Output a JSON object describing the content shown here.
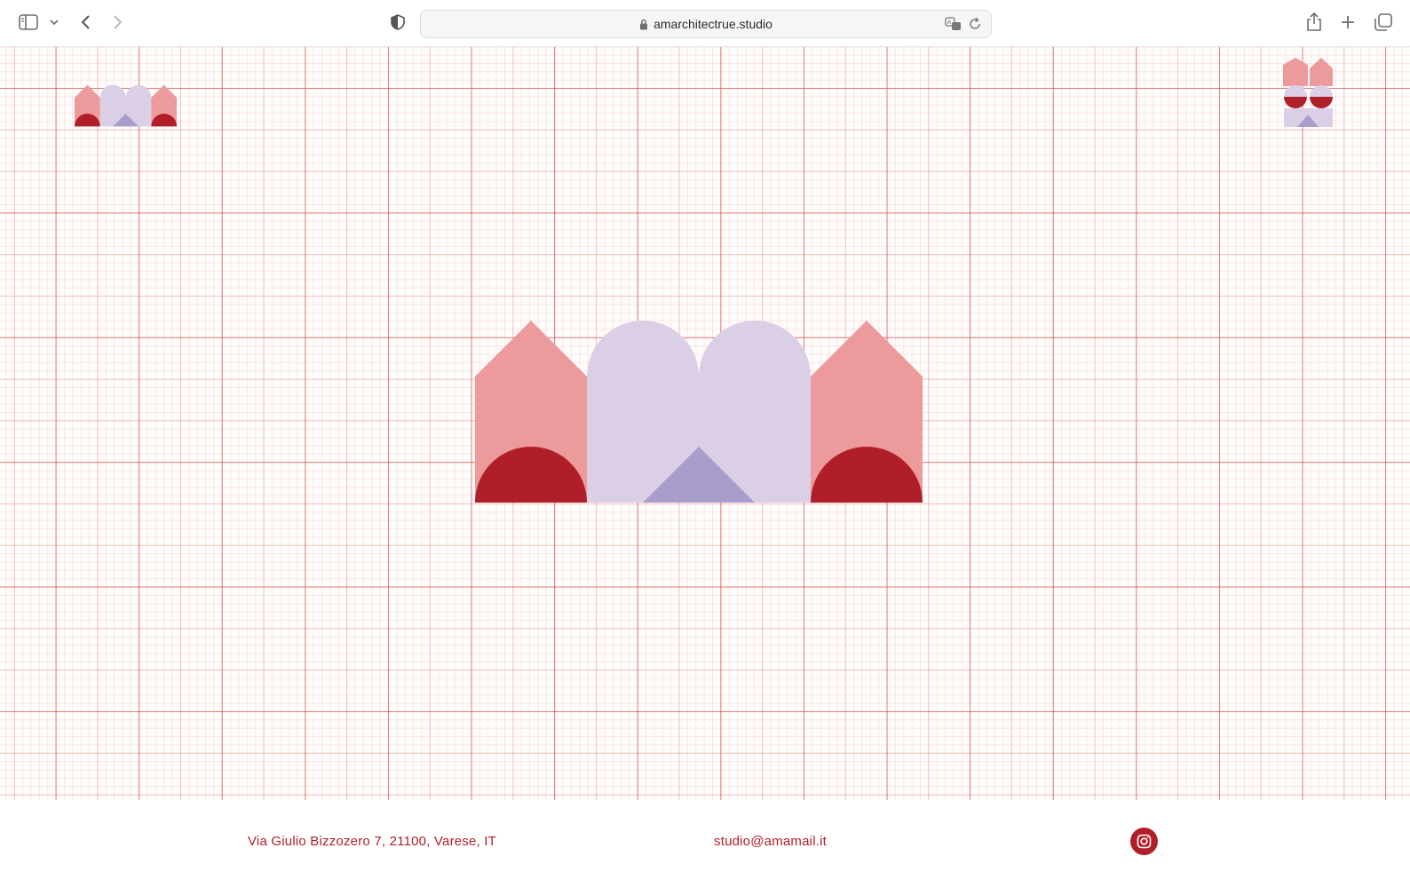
{
  "browser": {
    "url": "amarchitectrue.studio",
    "icons": {
      "sidebar": "sidebar-icon",
      "chevron": "chevron-down-icon",
      "back": "back-arrow-icon",
      "forward": "forward-arrow-icon",
      "shield": "privacy-shield-icon",
      "lock": "lock-icon",
      "translate": "translate-icon",
      "reload": "reload-icon",
      "share": "share-icon",
      "new_tab": "plus-icon",
      "tabs": "tabs-overview-icon"
    }
  },
  "colors": {
    "pink": "#ec9a9b",
    "lavender": "#dbcfe6",
    "violet": "#a99ecb",
    "crimson": "#b01e2a",
    "grid_line": "#d24646"
  },
  "footer": {
    "address": "Via Giulio Bizzozero 7, 21100, Varese, IT",
    "email": "studio@amamail.it",
    "social_icon": "instagram-icon"
  }
}
